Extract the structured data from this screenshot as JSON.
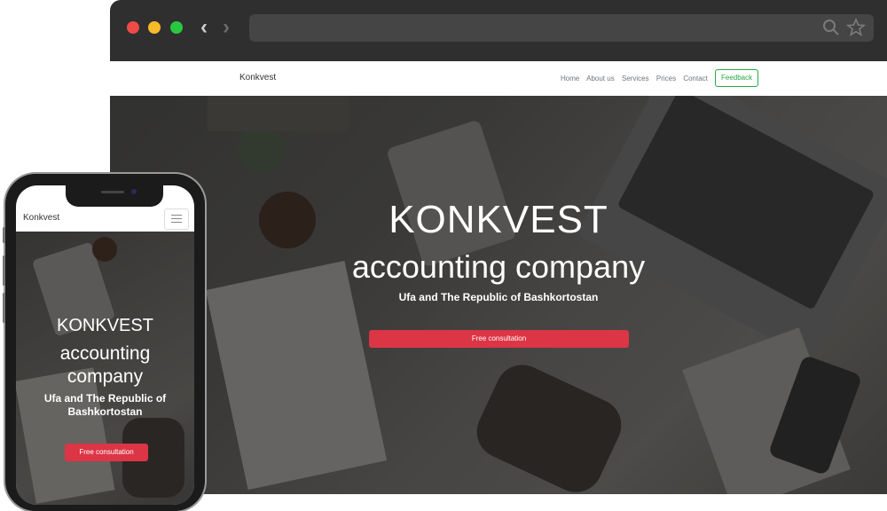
{
  "browser": {
    "icons": [
      "chevron-left-icon",
      "chevron-right-icon",
      "search-icon",
      "star-icon"
    ],
    "colors": {
      "close": "#ef4a45",
      "minimize": "#f6bb2a",
      "maximize": "#28c840",
      "chrome": "#2f2f2f"
    }
  },
  "site": {
    "logo": "Konkvest",
    "nav": [
      "Home",
      "About us",
      "Services",
      "Prices",
      "Contact"
    ],
    "feedback": "Feedback"
  },
  "hero": {
    "title": "KONKVEST",
    "subtitle": "accounting company",
    "location": "Ufa and The Republic of Bashkortostan",
    "button": "Free consultation"
  },
  "mobile": {
    "logo": "Konkvest",
    "title": "KONKVEST",
    "subtitle": "accounting company",
    "location": "Ufa and The Republic of Bashkortostan",
    "button": "Free consultation"
  },
  "colors": {
    "accent": "#dc3545",
    "feedback": "#28a745"
  }
}
